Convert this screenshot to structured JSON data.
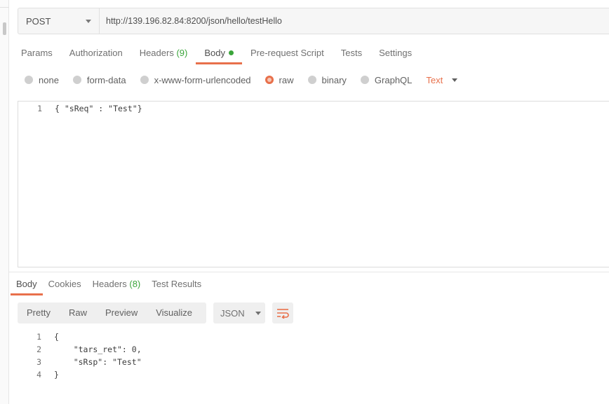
{
  "request": {
    "method": "POST",
    "url": "http://139.196.82.84:8200/json/hello/testHello"
  },
  "request_tabs": [
    {
      "label": "Params",
      "count": ""
    },
    {
      "label": "Authorization",
      "count": ""
    },
    {
      "label": "Headers",
      "count": "(9)"
    },
    {
      "label": "Body",
      "count": ""
    },
    {
      "label": "Pre-request Script",
      "count": ""
    },
    {
      "label": "Tests",
      "count": ""
    },
    {
      "label": "Settings",
      "count": ""
    }
  ],
  "active_request_tab": "Body",
  "body_types": [
    "none",
    "form-data",
    "x-www-form-urlencoded",
    "raw",
    "binary",
    "GraphQL"
  ],
  "selected_body_type": "raw",
  "raw_language": "Text",
  "request_body": {
    "lines": [
      {
        "num": "1",
        "text": "{ \"sReq\" : \"Test\"}"
      }
    ]
  },
  "response_tabs": [
    {
      "label": "Body",
      "count": ""
    },
    {
      "label": "Cookies",
      "count": ""
    },
    {
      "label": "Headers",
      "count": "(8)"
    },
    {
      "label": "Test Results",
      "count": ""
    }
  ],
  "active_response_tab": "Body",
  "view_modes": [
    "Pretty",
    "Raw",
    "Preview",
    "Visualize"
  ],
  "response_format": "JSON",
  "response_body": {
    "lines": [
      {
        "num": "1",
        "text": "{"
      },
      {
        "num": "2",
        "text": "    \"tars_ret\": 0,"
      },
      {
        "num": "3",
        "text": "    \"sRsp\": \"Test\""
      },
      {
        "num": "4",
        "text": "}"
      }
    ]
  },
  "colors": {
    "accent": "#e8704b",
    "count_green": "#3ba53b",
    "json_string": "#1a5fb4"
  },
  "icons": {
    "method_dropdown": "chevron-down-icon",
    "language_dropdown": "chevron-down-icon",
    "wrap": "wrap-lines-icon"
  }
}
